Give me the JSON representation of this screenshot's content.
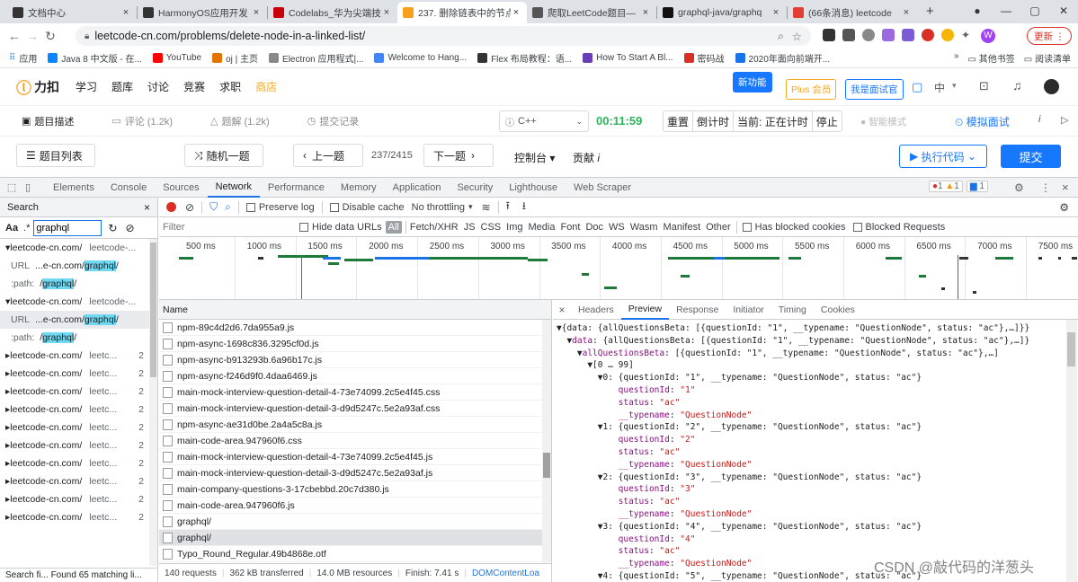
{
  "tabs": [
    {
      "title": "文档中心",
      "color": "#333"
    },
    {
      "title": "HarmonyOS应用开发",
      "color": "#333"
    },
    {
      "title": "Codelabs_华为尖端技",
      "color": "#c7000b"
    },
    {
      "title": "237. 删除链表中的节点",
      "color": "#f89f1b"
    },
    {
      "title": "爬取LeetCode题目—",
      "color": "#555"
    },
    {
      "title": "graphql-java/graphq",
      "color": "#111"
    },
    {
      "title": "(66条消息) leetcode",
      "color": "#e33e33"
    }
  ],
  "address": {
    "url": "leetcode-cn.com/problems/delete-node-in-a-linked-list/",
    "update_label": "更新 ⋮",
    "avatar": "W"
  },
  "bookmarks": [
    "应用",
    "Java 8 中文版 - 在...",
    "YouTube",
    "oj | 主页",
    "Electron 应用程式|...",
    "Welcome to Hang...",
    "Flex 布局教程：语...",
    "How To Start A Bl...",
    "密码战",
    "2020年面向前端开..."
  ],
  "bookmarks_right": [
    "其他书签",
    "阅读清单"
  ],
  "lc_nav": {
    "logo": "力扣",
    "items": [
      "学习",
      "题库",
      "讨论",
      "竞赛",
      "求职",
      "商店"
    ],
    "new_feature": "新功能",
    "plus": "Plus 会员",
    "interview": "我是面试官",
    "lang": "中"
  },
  "lc_tabs": {
    "desc": "题目描述",
    "comments": "评论 (1.2k)",
    "solutions": "题解 (1.2k)",
    "submissions": "提交记录",
    "language": "C++",
    "timer": "00:11:59",
    "reset": "重置",
    "countdown": "倒计时",
    "current": "当前: 正在计时",
    "stop": "停止",
    "smart": "智能模式",
    "mock": "模拟面试",
    "i": "i"
  },
  "lc_bottom": {
    "list": "题目列表",
    "random": "随机一题",
    "prev": "上一题",
    "progress": "237/2415",
    "next": "下一题",
    "console": "控制台",
    "contribute": "贡献",
    "run": "执行代码",
    "submit": "提交"
  },
  "devtools_tabs": [
    "Elements",
    "Console",
    "Sources",
    "Network",
    "Performance",
    "Memory",
    "Application",
    "Security",
    "Lighthouse",
    "Web Scraper"
  ],
  "devtools_status": {
    "errors": "1",
    "warnings": "1",
    "messages": "1"
  },
  "search": {
    "title": "Search",
    "aa": "Aa",
    "regex": ".*",
    "query": "graphql",
    "results": [
      {
        "domain": "leetcode-cn.com/",
        "short": "leetcode-...",
        "count": ""
      },
      {
        "domain": "leetcode-cn.com/",
        "short": "leetcode-...",
        "count": ""
      },
      {
        "domain": "leetcode-cn.com/",
        "short": "leetc...",
        "count": "2"
      },
      {
        "domain": "leetcode-cn.com/",
        "short": "leetc...",
        "count": "2"
      },
      {
        "domain": "leetcode-cn.com/",
        "short": "leetc...",
        "count": "2"
      },
      {
        "domain": "leetcode-cn.com/",
        "short": "leetc...",
        "count": "2"
      },
      {
        "domain": "leetcode-cn.com/",
        "short": "leetc...",
        "count": "2"
      },
      {
        "domain": "leetcode-cn.com/",
        "short": "leetc...",
        "count": "2"
      },
      {
        "domain": "leetcode-cn.com/",
        "short": "leetc...",
        "count": "2"
      },
      {
        "domain": "leetcode-cn.com/",
        "short": "leetc...",
        "count": "2"
      },
      {
        "domain": "leetcode-cn.com/",
        "short": "leetc...",
        "count": "2"
      },
      {
        "domain": "leetcode-cn.com/",
        "short": "leetc...",
        "count": "2"
      }
    ],
    "url_label": "URL",
    "url_prefix": "...e-cn.com/",
    "url_hit": "graphql",
    "url_suffix": "/",
    "path_label": ":path:",
    "path_prefix": "/",
    "path_hit": "graphql",
    "path_suffix": "/",
    "footer": "Search fi...   Found 65 matching li..."
  },
  "network": {
    "preserve": "Preserve log",
    "disable_cache": "Disable cache",
    "throttle": "No throttling",
    "filter_placeholder": "Filter",
    "hide_data": "Hide data URLs",
    "all": "All",
    "types": [
      "Fetch/XHR",
      "JS",
      "CSS",
      "Img",
      "Media",
      "Font",
      "Doc",
      "WS",
      "Wasm",
      "Manifest",
      "Other"
    ],
    "blocked_cookies": "Has blocked cookies",
    "blocked_req": "Blocked Requests",
    "ticks": [
      "500 ms",
      "1000 ms",
      "1500 ms",
      "2000 ms",
      "2500 ms",
      "3000 ms",
      "3500 ms",
      "4000 ms",
      "4500 ms",
      "5000 ms",
      "5500 ms",
      "6000 ms",
      "6500 ms",
      "7000 ms",
      "7500 ms"
    ],
    "name_header": "Name",
    "requests": [
      "npm-89c4d2d6.7da955a9.js",
      "npm-async-1698c836.3295cf0d.js",
      "npm-async-b913293b.6a96b17c.js",
      "npm-async-f246d9f0.4daa6469.js",
      "main-mock-interview-question-detail-4-73e74099.2c5e4f45.css",
      "main-mock-interview-question-detail-3-d9d5247c.5e2a93af.css",
      "npm-async-ae31d0be.2a4a5c8a.js",
      "main-code-area.947960f6.css",
      "main-mock-interview-question-detail-4-73e74099.2c5e4f45.js",
      "main-mock-interview-question-detail-3-d9d5247c.5e2a93af.js",
      "main-company-questions-3-17cbebbd.20c7d380.js",
      "main-code-area.947960f6.js",
      "graphql/",
      "graphql/",
      "Typo_Round_Regular.49b4868e.otf"
    ],
    "status": [
      "140 requests",
      "362 kB transferred",
      "14.0 MB resources",
      "Finish: 7.41 s",
      "DOMContentLoa"
    ]
  },
  "preview": {
    "tabs": [
      "Headers",
      "Preview",
      "Response",
      "Initiator",
      "Timing",
      "Cookies"
    ],
    "close": "×",
    "lines": [
      "▼{data: {allQuestionsBeta: [{questionId: \"1\", __typename: \"QuestionNode\", status: \"ac\"},…]}}",
      "  ▼data: {allQuestionsBeta: [{questionId: \"1\", __typename: \"QuestionNode\", status: \"ac\"},…]}",
      "    ▼allQuestionsBeta: [{questionId: \"1\", __typename: \"QuestionNode\", status: \"ac\"},…]",
      "      ▼[0 … 99]",
      "        ▼0: {questionId: \"1\", __typename: \"QuestionNode\", status: \"ac\"}",
      "            questionId: \"1\"",
      "            status: \"ac\"",
      "            __typename: \"QuestionNode\"",
      "        ▼1: {questionId: \"2\", __typename: \"QuestionNode\", status: \"ac\"}",
      "            questionId: \"2\"",
      "            status: \"ac\"",
      "            __typename: \"QuestionNode\"",
      "        ▼2: {questionId: \"3\", __typename: \"QuestionNode\", status: \"ac\"}",
      "            questionId: \"3\"",
      "            status: \"ac\"",
      "            __typename: \"QuestionNode\"",
      "        ▼3: {questionId: \"4\", __typename: \"QuestionNode\", status: \"ac\"}",
      "            questionId: \"4\"",
      "            status: \"ac\"",
      "            __typename: \"QuestionNode\"",
      "        ▼4: {questionId: \"5\", __typename: \"QuestionNode\", status: \"ac\"}"
    ]
  },
  "watermark": "CSDN @敲代码的洋葱头"
}
